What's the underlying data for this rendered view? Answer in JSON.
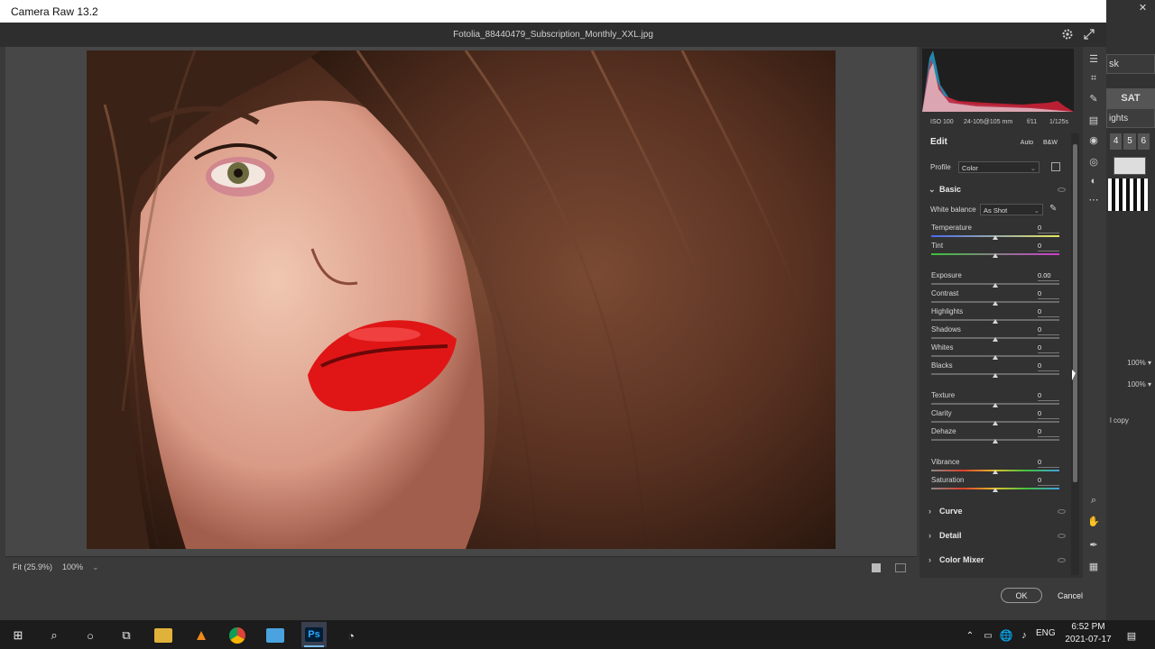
{
  "window": {
    "title": "Camera Raw 13.2",
    "filename": "Fotolia_88440479_Subscription_Monthly_XXL.jpg"
  },
  "camera_info": {
    "iso": "ISO 100",
    "lens": "24-105@105 mm",
    "aperture": "f/11",
    "shutter": "1/125s"
  },
  "edit": {
    "title": "Edit",
    "auto_label": "Auto",
    "bw_label": "B&W",
    "profile_label": "Profile",
    "profile_value": "Color"
  },
  "basic": {
    "title": "Basic",
    "white_balance_label": "White balance",
    "white_balance_value": "As Shot",
    "sliders": [
      {
        "label": "Temperature",
        "value": "0"
      },
      {
        "label": "Tint",
        "value": "0"
      },
      {
        "label": "Exposure",
        "value": "0.00"
      },
      {
        "label": "Contrast",
        "value": "0"
      },
      {
        "label": "Highlights",
        "value": "0"
      },
      {
        "label": "Shadows",
        "value": "0"
      },
      {
        "label": "Whites",
        "value": "0"
      },
      {
        "label": "Blacks",
        "value": "0"
      },
      {
        "label": "Texture",
        "value": "0"
      },
      {
        "label": "Clarity",
        "value": "0"
      },
      {
        "label": "Dehaze",
        "value": "0"
      },
      {
        "label": "Vibrance",
        "value": "0"
      },
      {
        "label": "Saturation",
        "value": "0"
      }
    ]
  },
  "sections": [
    {
      "title": "Curve"
    },
    {
      "title": "Detail"
    },
    {
      "title": "Color Mixer"
    }
  ],
  "status": {
    "fit": "Fit (25.9%)",
    "zoom": "100%"
  },
  "buttons": {
    "ok": "OK",
    "cancel": "Cancel"
  },
  "photoshop_bg": {
    "mask": "sk",
    "sat": "SAT",
    "lights": "ights",
    "digits": [
      "4",
      "5",
      "6"
    ],
    "zoom1": "100%",
    "zoom2": "100%",
    "layer": "l copy"
  },
  "taskbar": {
    "lang": "ENG",
    "time": "6:52 PM",
    "date": "2021-07-17",
    "ps_label": "Ps"
  },
  "colors": {
    "accent": "#2b7de9",
    "panel": "#323232",
    "window": "#3a3a3a"
  }
}
